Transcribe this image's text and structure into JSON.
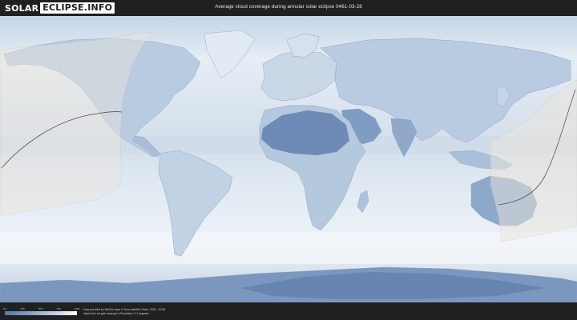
{
  "header": {
    "logo_left": "SOLAR",
    "logo_right": "ECLIPSE.INFO",
    "title": "Average cloud coverage during annular solar eclipse 0461-03-28"
  },
  "legend": {
    "ticks": [
      "0%",
      "25%",
      "50%",
      "75%",
      "100%"
    ],
    "ramp_colors": [
      "#5576a6",
      "#8ea8c9",
      "#c9d7e7",
      "#ffffff"
    ]
  },
  "credits": {
    "line1": "Data provided by NASAs Aqua & Terra satellite (Years: 2000 - 2019)",
    "line2": "https://neo.sci.gsfc.nasa.gov  |  Resolution: 0.1 degrees"
  },
  "colors": {
    "background": "#202020",
    "ocean": "#dfe8f2",
    "land_cloudy": "#8aa6c9",
    "land_clear": "#6686b4",
    "eclipse_zone": "#e8e4dc",
    "central_line": "#555555"
  }
}
